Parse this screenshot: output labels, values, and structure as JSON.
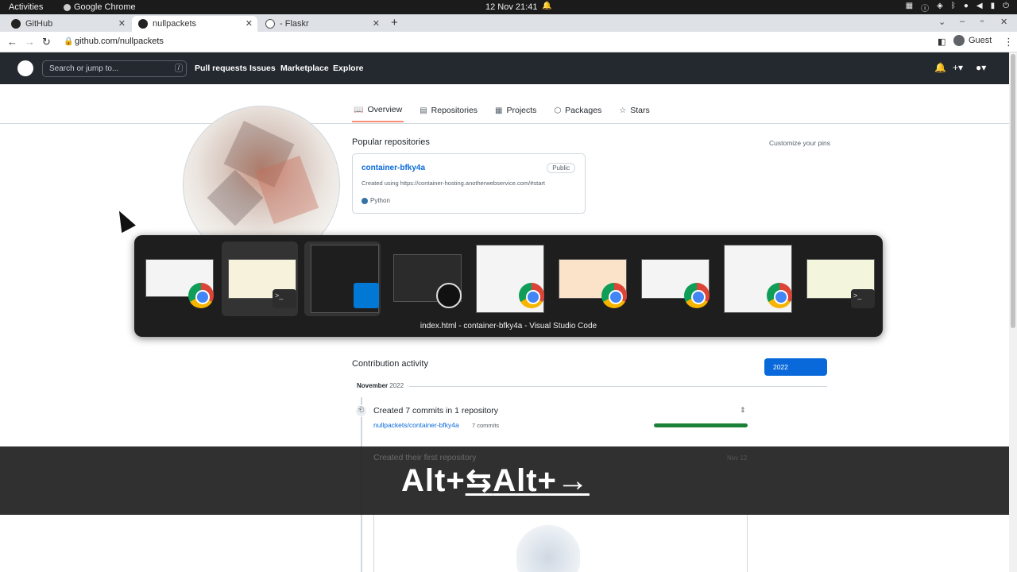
{
  "system_bar": {
    "activities": "Activities",
    "app_name": "Google Chrome",
    "clock": "12 Nov  21:41"
  },
  "browser": {
    "tabs": [
      {
        "label": "GitHub"
      },
      {
        "label": "nullpackets"
      },
      {
        "label": "- Flaskr"
      }
    ],
    "new_tab": "+",
    "url": "github.com/nullpackets",
    "profile": "Guest"
  },
  "github": {
    "search_placeholder": "Search or jump to...",
    "search_shortcut": "/",
    "nav": [
      "Pull requests",
      "Issues",
      "Marketplace",
      "Explore"
    ],
    "profile_tabs": [
      {
        "label": "Overview",
        "icon": "book-icon"
      },
      {
        "label": "Repositories",
        "icon": "repo-icon"
      },
      {
        "label": "Projects",
        "icon": "table-icon"
      },
      {
        "label": "Packages",
        "icon": "package-icon"
      },
      {
        "label": "Stars",
        "icon": "star-icon"
      }
    ],
    "popular_title": "Popular repositories",
    "customize": "Customize your pins",
    "repo": {
      "name": "container-bfky4a",
      "visibility": "Public",
      "description": "Created using https://container-hosting.anotherwebservice.com/#start",
      "language": "Python",
      "language_color": "#3572A5"
    },
    "contribution": {
      "title": "Contribution activity",
      "year": "2022",
      "month_bold": "November",
      "month_year": "2022",
      "commits_heading": "Created 7 commits in 1 repository",
      "commits_repo": "nullpackets/container-bfky4a",
      "commits_count": "7 commits",
      "first_repo": "Created their first repository",
      "first_repo_date": "Nov 12"
    }
  },
  "switcher": {
    "caption": "index.html - container-bfky4a - Visual Studio Code",
    "apps": [
      "chrome",
      "terminal",
      "vscode",
      "obs",
      "chrome",
      "chrome",
      "chrome",
      "chrome",
      "terminal"
    ],
    "selected_index": 2
  },
  "keystrokes": {
    "first": "Alt+",
    "tab_glyph": "⇆",
    "second": "Alt+→"
  }
}
